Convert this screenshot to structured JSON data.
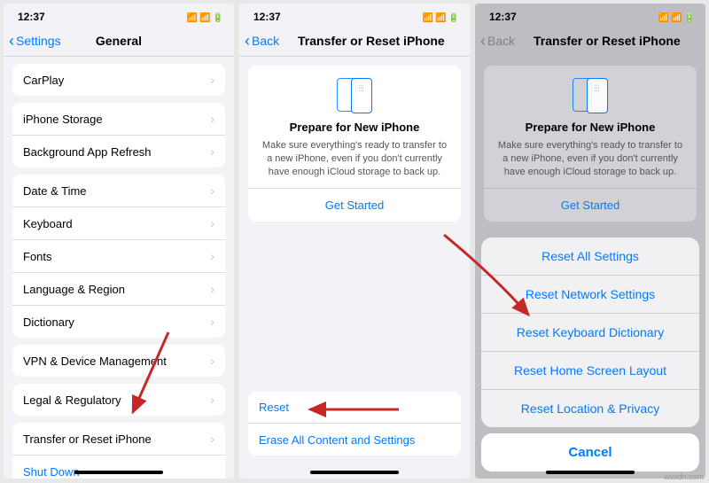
{
  "status": {
    "time": "12:37"
  },
  "screen1": {
    "back": "Settings",
    "title": "General",
    "rows": {
      "carplay": "CarPlay",
      "storage": "iPhone Storage",
      "bgRefresh": "Background App Refresh",
      "dateTime": "Date & Time",
      "keyboard": "Keyboard",
      "fonts": "Fonts",
      "langRegion": "Language & Region",
      "dictionary": "Dictionary",
      "vpn": "VPN & Device Management",
      "legal": "Legal & Regulatory",
      "transfer": "Transfer or Reset iPhone",
      "shutdown": "Shut Down"
    }
  },
  "screen2": {
    "back": "Back",
    "title": "Transfer or Reset iPhone",
    "card": {
      "heading": "Prepare for New iPhone",
      "body": "Make sure everything's ready to transfer to a new iPhone, even if you don't currently have enough iCloud storage to back up.",
      "cta": "Get Started"
    },
    "reset": "Reset",
    "erase": "Erase All Content and Settings"
  },
  "screen3": {
    "back": "Back",
    "title": "Transfer or Reset iPhone",
    "card": {
      "heading": "Prepare for New iPhone",
      "body": "Make sure everything's ready to transfer to a new iPhone, even if you don't currently have enough iCloud storage to back up.",
      "cta": "Get Started"
    },
    "sheet": {
      "opt1": "Reset All Settings",
      "opt2": "Reset Network Settings",
      "opt3": "Reset Keyboard Dictionary",
      "opt4": "Reset Home Screen Layout",
      "opt5": "Reset Location & Privacy",
      "cancel": "Cancel"
    }
  },
  "watermark": "wsxdn.com"
}
